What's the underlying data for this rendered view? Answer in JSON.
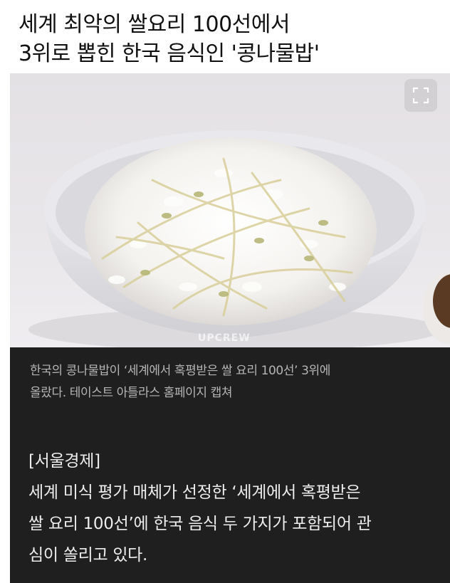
{
  "headline": {
    "line1": "세계 최악의 쌀요리 100선에서",
    "line2": "3위로 뽑힌 한국 음식인 '콩나물밥'"
  },
  "photo": {
    "watermark": "UPCREW",
    "expand_icon": "expand-icon"
  },
  "caption": {
    "line1": "한국의 콩나물밥이 ‘세계에서 혹평받은 쌀 요리 100선’ 3위에",
    "line2": "올랐다. 테이스트 아틀라스 홈페이지 캡쳐"
  },
  "article": {
    "source": "[서울경제]",
    "line1": "세계 미식 평가 매체가 선정한 ‘세계에서 혹평받은",
    "line2": "쌀 요리 100선’에 한국 음식 두 가지가 포함되어 관",
    "line3": "심이 쏠리고 있다."
  },
  "colors": {
    "dark_bg": "#1f1f1f",
    "caption_text": "#b5b5b5",
    "body_text": "#ededed"
  }
}
